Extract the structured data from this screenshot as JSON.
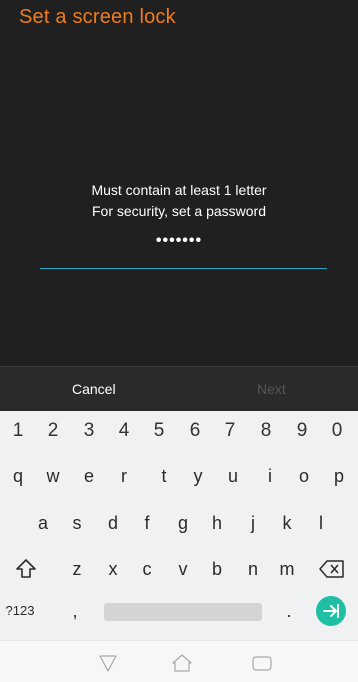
{
  "header": {
    "title": "Set a screen lock"
  },
  "messages": {
    "line1": "Must contain at least 1 letter",
    "line2": "For security, set a password"
  },
  "password": {
    "masked_value": "•••••••"
  },
  "actions": {
    "cancel": "Cancel",
    "next": "Next"
  },
  "keyboard": {
    "numbers": [
      "1",
      "2",
      "3",
      "4",
      "5",
      "6",
      "7",
      "8",
      "9",
      "0"
    ],
    "row1": [
      "q",
      "w",
      "e",
      "r",
      "t",
      "y",
      "u",
      "i",
      "o",
      "p"
    ],
    "row2": [
      "a",
      "s",
      "d",
      "f",
      "g",
      "h",
      "j",
      "k",
      "l"
    ],
    "row3": [
      "z",
      "x",
      "c",
      "v",
      "b",
      "n",
      "m"
    ],
    "symbols_label": "?123",
    "comma": ",",
    "period": "."
  },
  "colors": {
    "title": "#f07c1e",
    "accent": "#1fa9c7",
    "enter": "#1fbfa6"
  },
  "icons": {
    "shift": "shift-icon",
    "backspace": "backspace-icon",
    "enter": "enter-icon",
    "back": "nav-back-icon",
    "home": "nav-home-icon",
    "recents": "nav-recents-icon"
  }
}
